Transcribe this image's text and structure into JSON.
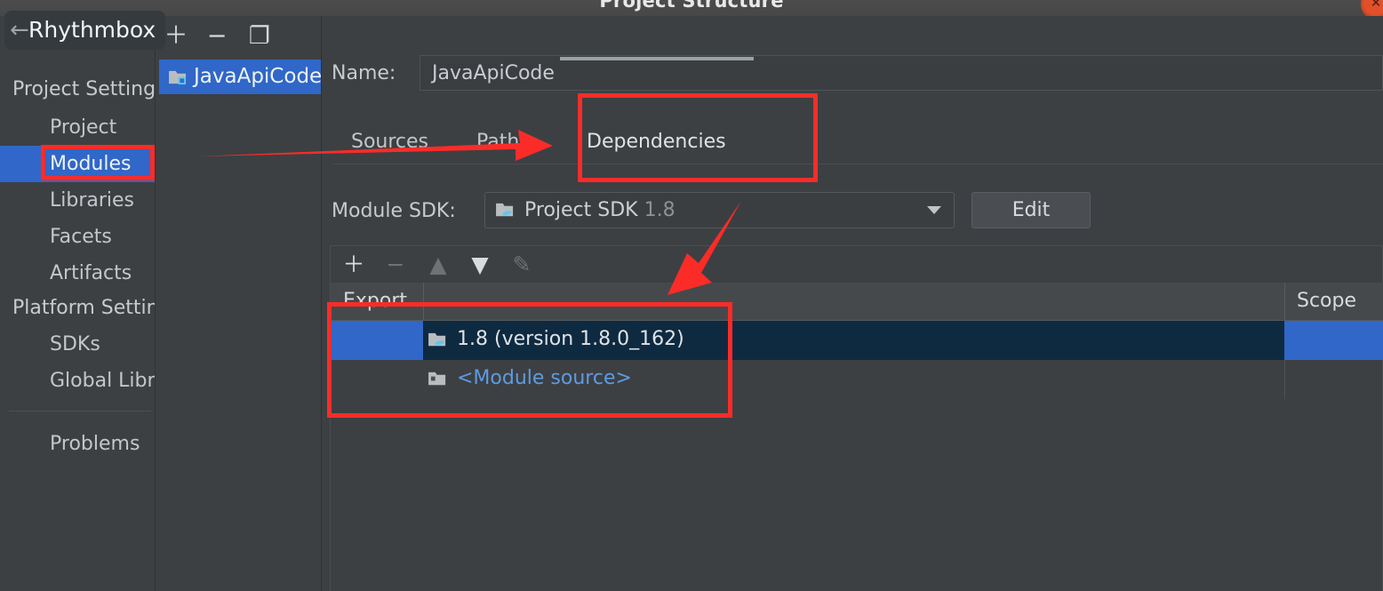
{
  "window": {
    "title": "Project Structure",
    "close_icon": "close-icon",
    "close_glyph": "✕"
  },
  "overlay": {
    "back_icon": "←",
    "app_label": "Rhythmbox"
  },
  "sidebar": {
    "items": [
      {
        "label": "Project Settings",
        "type": "group",
        "selected": false
      },
      {
        "label": "Project",
        "type": "child",
        "selected": false
      },
      {
        "label": "Modules",
        "type": "child",
        "selected": true
      },
      {
        "label": "Libraries",
        "type": "child",
        "selected": false
      },
      {
        "label": "Facets",
        "type": "child",
        "selected": false
      },
      {
        "label": "Artifacts",
        "type": "child",
        "selected": false
      },
      {
        "label": "Platform Settings",
        "type": "group",
        "selected": false
      },
      {
        "label": "SDKs",
        "type": "child",
        "selected": false
      },
      {
        "label": "Global Libraries",
        "type": "child",
        "selected": false
      },
      {
        "label": "Problems",
        "type": "child",
        "selected": false
      }
    ]
  },
  "module_panel": {
    "toolbar": [
      {
        "icon": "plus-icon",
        "glyph": "＋"
      },
      {
        "icon": "minus-icon",
        "glyph": "−"
      },
      {
        "icon": "copy-icon",
        "glyph": "❐"
      }
    ],
    "module": {
      "label": "JavaApiCode",
      "icon": "module-folder-icon",
      "selected": true
    }
  },
  "form": {
    "name_label": "Name:",
    "name_value": "JavaApiCode"
  },
  "tabs": [
    {
      "label": "Sources",
      "active": false
    },
    {
      "label": "Paths",
      "active": false
    },
    {
      "label": "Dependencies",
      "active": true
    }
  ],
  "sdk": {
    "label": "Module SDK:",
    "value": "Project SDK",
    "version": "1.8",
    "icon": "sdk-folder-icon",
    "dropdown_icon": "chevron-down-icon",
    "edit_label": "Edit"
  },
  "dep_toolbar": [
    {
      "icon": "add-dependency-icon",
      "glyph": "＋",
      "enabled": true
    },
    {
      "icon": "remove-dependency-icon",
      "glyph": "−",
      "enabled": false
    },
    {
      "icon": "move-up-icon",
      "glyph": "▲",
      "enabled": false
    },
    {
      "icon": "move-down-icon",
      "glyph": "▼",
      "enabled": true
    },
    {
      "icon": "edit-pencil-icon",
      "glyph": "✎",
      "enabled": false
    }
  ],
  "table": {
    "columns": [
      {
        "label": "Export"
      },
      {
        "label": ""
      },
      {
        "label": "Scope"
      }
    ],
    "rows": [
      {
        "export_checked": true,
        "icon": "sdk-folder-icon",
        "name": "1.8 (version 1.8.0_162)",
        "scope": "",
        "selected": true,
        "style": "sdk"
      },
      {
        "export_checked": false,
        "icon": "module-source-icon",
        "name": "<Module source>",
        "scope": "",
        "selected": false,
        "style": "modsrc"
      }
    ]
  },
  "annotations": {
    "color": "#fb2c28",
    "boxes": [
      "modules-highlight",
      "dependencies-tab-highlight",
      "dependency-rows-highlight"
    ],
    "arrows": [
      "arrow-to-dependencies-tab",
      "arrow-to-sdk-row"
    ]
  }
}
